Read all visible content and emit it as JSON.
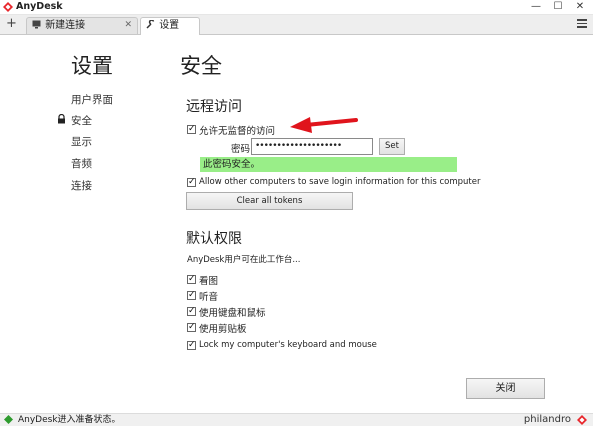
{
  "window": {
    "title": "AnyDesk",
    "controls": {
      "minimize": "—",
      "maximize": "☐",
      "close": "✕"
    }
  },
  "tabs": {
    "add_label": "+",
    "items": [
      {
        "label": "新建连接",
        "icon": "monitor-icon",
        "close": "✕"
      },
      {
        "label": "设置",
        "icon": "wrench-icon",
        "active": true
      }
    ]
  },
  "nav": {
    "title": "设置",
    "items": [
      "用户界面",
      "安全",
      "显示",
      "音频",
      "连接"
    ],
    "active_index": 1
  },
  "section": {
    "title": "安全",
    "remote": {
      "heading": "远程访问",
      "unattended_label": "允许无监督的访问",
      "password_label": "密码:",
      "password_value": "••••••••••••••••••••",
      "set_button": "Set",
      "strength_text": "此密码安全。",
      "strength_color": "#99ee88",
      "save_login_label": "Allow other computers to save login information for this computer",
      "clear_tokens_button": "Clear all tokens"
    },
    "permissions": {
      "heading": "默认权限",
      "description": "AnyDesk用户可在此工作台...",
      "items": [
        "看图",
        "听音",
        "使用键盘和鼠标",
        "使用剪贴板",
        "Lock my computer's keyboard and mouse"
      ]
    }
  },
  "footer": {
    "close_button": "关闭"
  },
  "statusbar": {
    "text": "AnyDesk进入准备状态。",
    "brand": "philandro"
  },
  "colors": {
    "brand_red": "#e8262c",
    "arrow_red": "#e0141c",
    "strength_green": "#99ee88"
  }
}
